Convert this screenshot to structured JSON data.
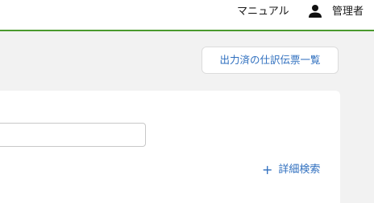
{
  "header": {
    "manual_label": "マニュアル",
    "user_label": "管理者",
    "user_icon": "person-icon",
    "accent_color": "#4a9a2e"
  },
  "toolbar": {
    "history_button_label": "出力済の仕訳伝票一覧"
  },
  "search": {
    "input_value": "",
    "advanced_search_label": "詳細検索",
    "advanced_search_icon": "plus-icon"
  },
  "colors": {
    "link_blue": "#2f6fbf",
    "page_background": "#f2f2f2"
  }
}
